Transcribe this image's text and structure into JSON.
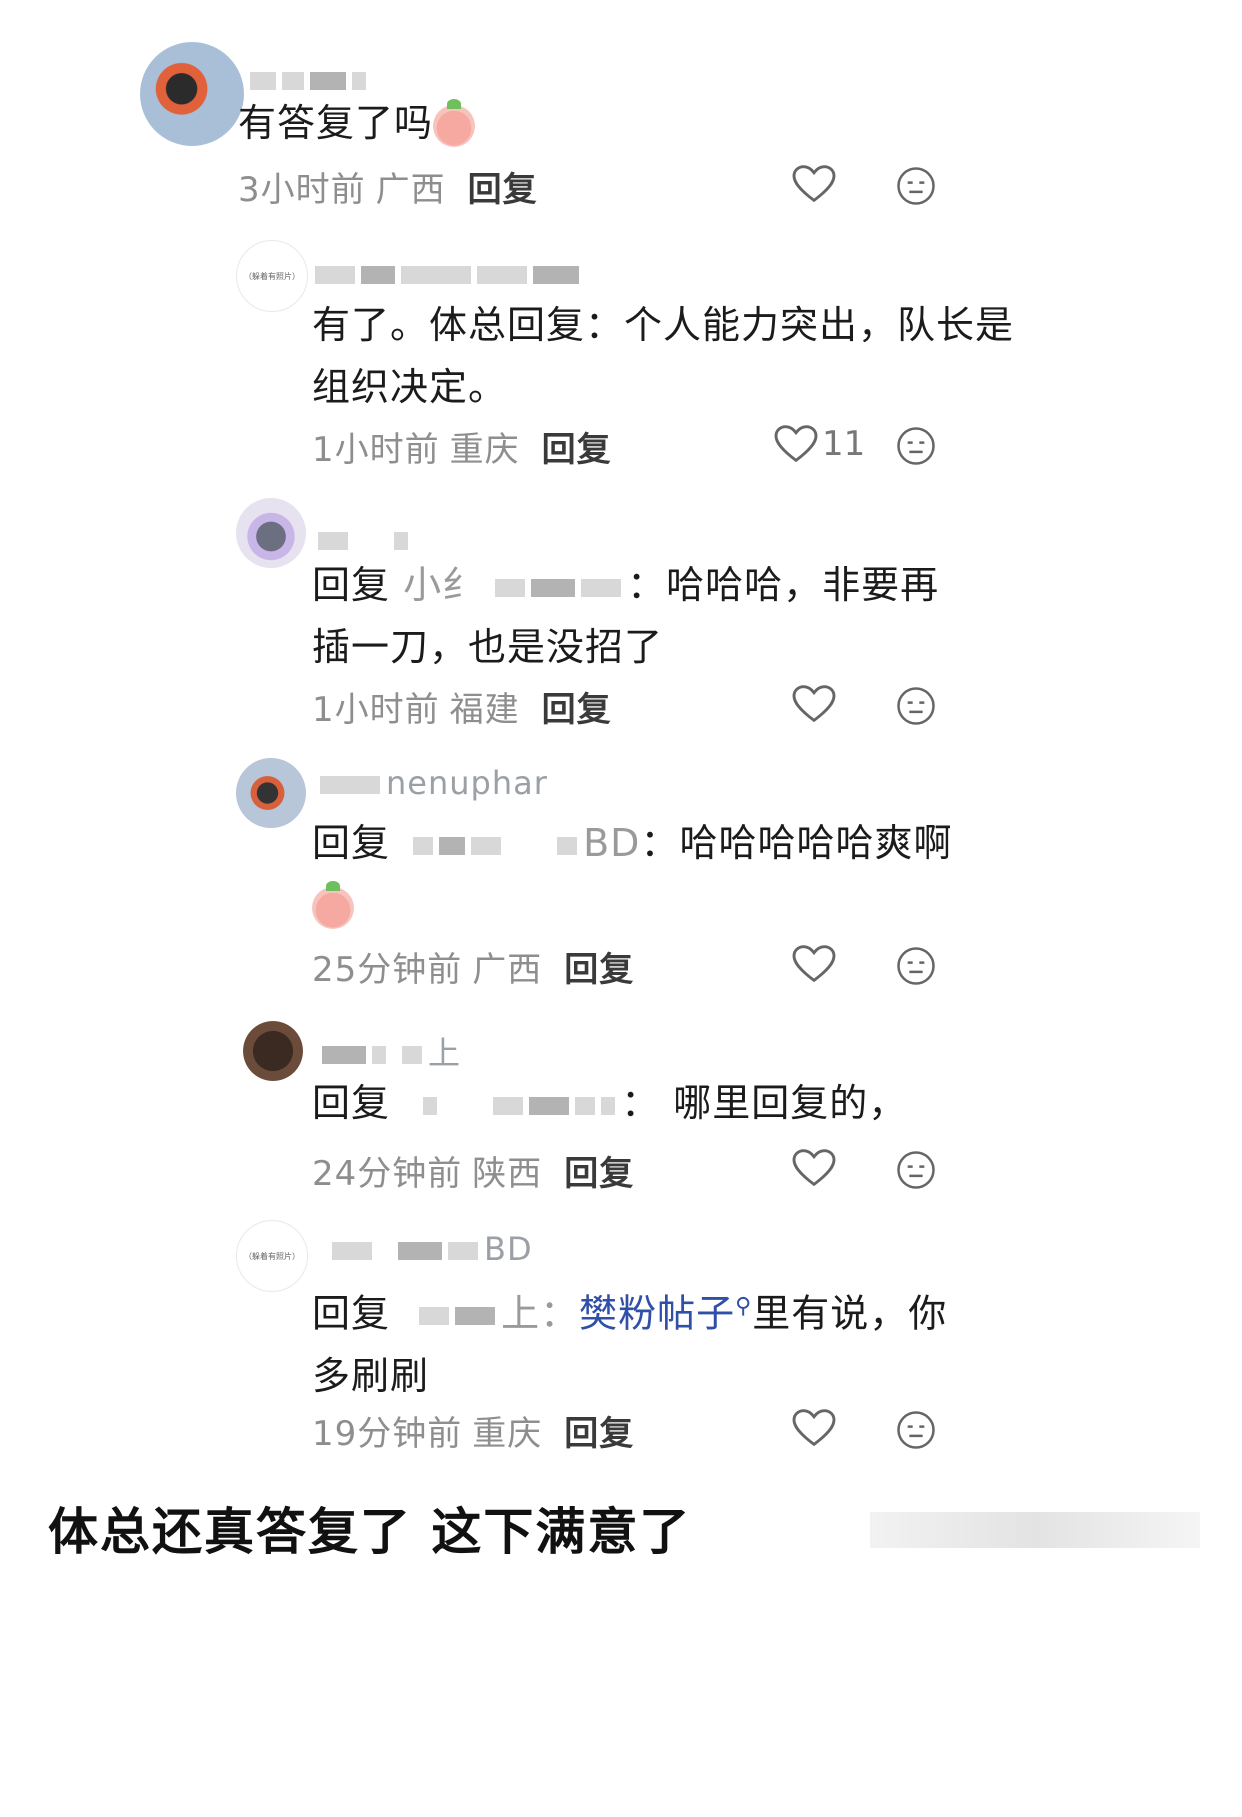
{
  "comments": [
    {
      "text": "有答复了吗",
      "time": "3小时前",
      "location": "广西",
      "reply_label": "回复",
      "like_count": ""
    },
    {
      "text_line1": "有了。体总回复：个人能力突出，队长是",
      "text_line2": "组织决定。",
      "time": "1小时前",
      "location": "重庆",
      "reply_label": "回复",
      "like_count": "11",
      "avatar_text": "（躲着有照片）"
    },
    {
      "prefix": "回复",
      "target": "小纟",
      "text_line1": "：哈哈哈，非要再",
      "text_line2": "插一刀，也是没招了",
      "time": "1小时前",
      "location": "福建",
      "reply_label": "回复"
    },
    {
      "name_visible": "nenuphar",
      "prefix": "回复",
      "target": "BD",
      "text_line1": "：哈哈哈哈哈爽啊",
      "time": "25分钟前",
      "location": "广西",
      "reply_label": "回复"
    },
    {
      "name_visible": "上",
      "prefix": "回复",
      "text_line1": "：  哪里回复的，",
      "time": "24分钟前",
      "location": "陕西",
      "reply_label": "回复"
    },
    {
      "name_visible": "BD",
      "prefix": "回复",
      "target": "上：",
      "link_text": "樊粉帖子",
      "text_after_link": "里有说，你",
      "text_line2": "多刷刷",
      "time": "19分钟前",
      "location": "重庆",
      "reply_label": "回复",
      "avatar_text": "（躲着有照片）"
    }
  ],
  "caption": "体总还真答复了 这下满意了",
  "icons": {
    "like": "heart-outline-icon",
    "dislike": "neutral-face-icon",
    "search_link": "search-icon"
  }
}
